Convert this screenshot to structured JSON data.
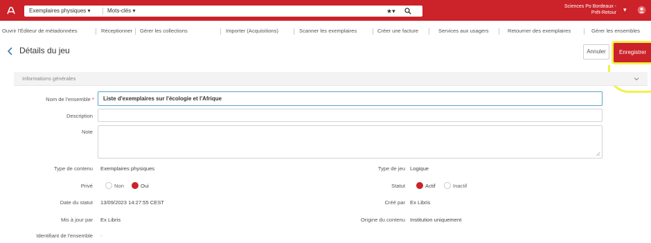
{
  "topbar": {
    "scope_label": "Exemplaires physiques",
    "scope2_label": "Mots-clés",
    "star_label": "★▾",
    "institution_line1": "Sciences Po Bordeaux -",
    "institution_line2": "Prêt-Retour",
    "caret": "▾"
  },
  "nav": {
    "items": [
      "Ouvrir l'Éditeur de métadonnées",
      "Réceptionner",
      "Gérer les collections",
      "Importer (Acquisitions)",
      "Scanner les exemplaires",
      "Créer une facture",
      "Services aux usagers",
      "Retourner des exemplaires",
      "Gérer les ensembles"
    ]
  },
  "header": {
    "title": "Détails du jeu",
    "cancel_label": "Annuler",
    "save_label": "Enregistrer"
  },
  "section": {
    "title": "Informations générales"
  },
  "form": {
    "name_label": "Nom de l'ensemble",
    "required_mark": "*",
    "name_value": "Liste d'exemplaires sur l'écologie et l'Afrique",
    "description_label": "Description",
    "note_label": "Note",
    "content_type_label": "Type de contenu",
    "content_type_value": "Exemplaires physiques",
    "set_type_label": "Type de jeu",
    "set_type_value": "Logique",
    "private_label": "Privé",
    "private_no": "Non",
    "private_yes": "Oui",
    "status_label": "Statut",
    "status_active": "Actif",
    "status_inactive": "Inactif",
    "status_date_label": "Date du statut",
    "status_date_value": "13/09/2023 14:27:55 CEST",
    "created_by_label": "Créé par",
    "created_by_value": "Ex Libris",
    "updated_by_label": "Mis à jour par",
    "updated_by_value": "Ex Libris",
    "content_origin_label": "Origine du contenu",
    "content_origin_value": "Institution uniquement",
    "set_id_label": "Identifiant de l'ensemble",
    "set_id_value": "-"
  }
}
